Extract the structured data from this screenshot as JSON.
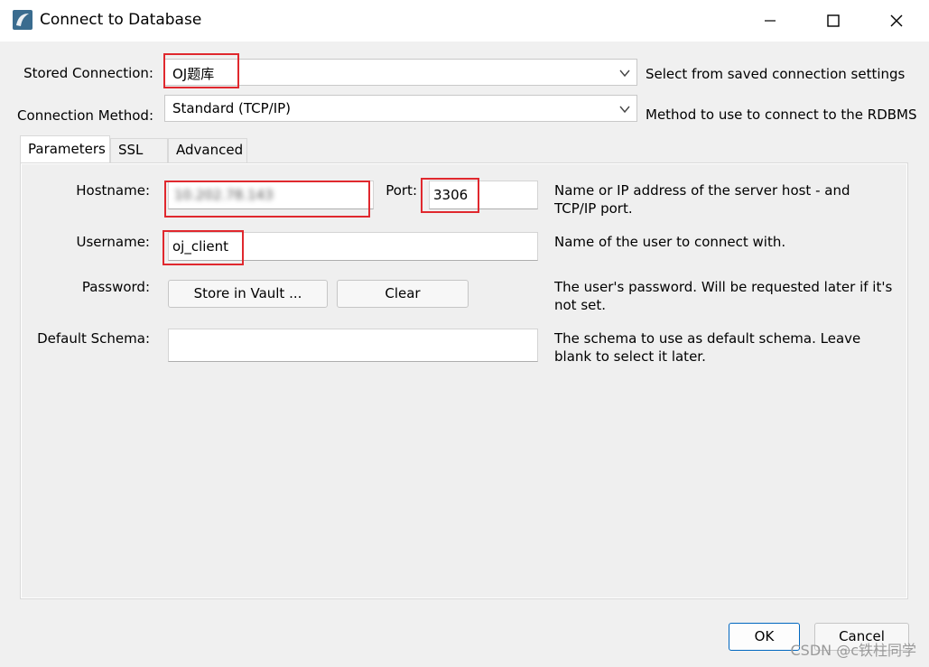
{
  "window": {
    "title": "Connect to Database",
    "controls": {
      "minimize_glyph": "—",
      "maximize_glyph": "☐",
      "close_glyph": "✕"
    }
  },
  "stored_connection": {
    "label": "Stored Connection:",
    "value": "OJ题库",
    "hint": "Select from saved connection settings"
  },
  "connection_method": {
    "label": "Connection Method:",
    "value": "Standard (TCP/IP)",
    "hint": "Method to use to connect to the RDBMS"
  },
  "tabs": [
    {
      "label": "Parameters",
      "active": true
    },
    {
      "label": "SSL",
      "active": false
    },
    {
      "label": "Advanced",
      "active": false
    }
  ],
  "parameters": {
    "hostname": {
      "label": "Hostname:",
      "value": "10.202.78.143"
    },
    "port": {
      "label": "Port:",
      "value": "3306"
    },
    "hostname_hint": "Name or IP address of the server host - and TCP/IP port.",
    "username": {
      "label": "Username:",
      "value": "oj_client",
      "hint": "Name of the user to connect with."
    },
    "password": {
      "label": "Password:",
      "store_button": "Store in Vault ...",
      "clear_button": "Clear",
      "hint": "The user's password. Will be requested later if it's not set."
    },
    "default_schema": {
      "label": "Default Schema:",
      "value": "",
      "hint": "The schema to use as default schema. Leave blank to select it later."
    }
  },
  "footer": {
    "ok_label": "OK",
    "cancel_label": "Cancel"
  },
  "watermark": "CSDN @c铁柱同学",
  "colors": {
    "highlight_box": "#e0282e",
    "ok_border": "#0067c0"
  }
}
